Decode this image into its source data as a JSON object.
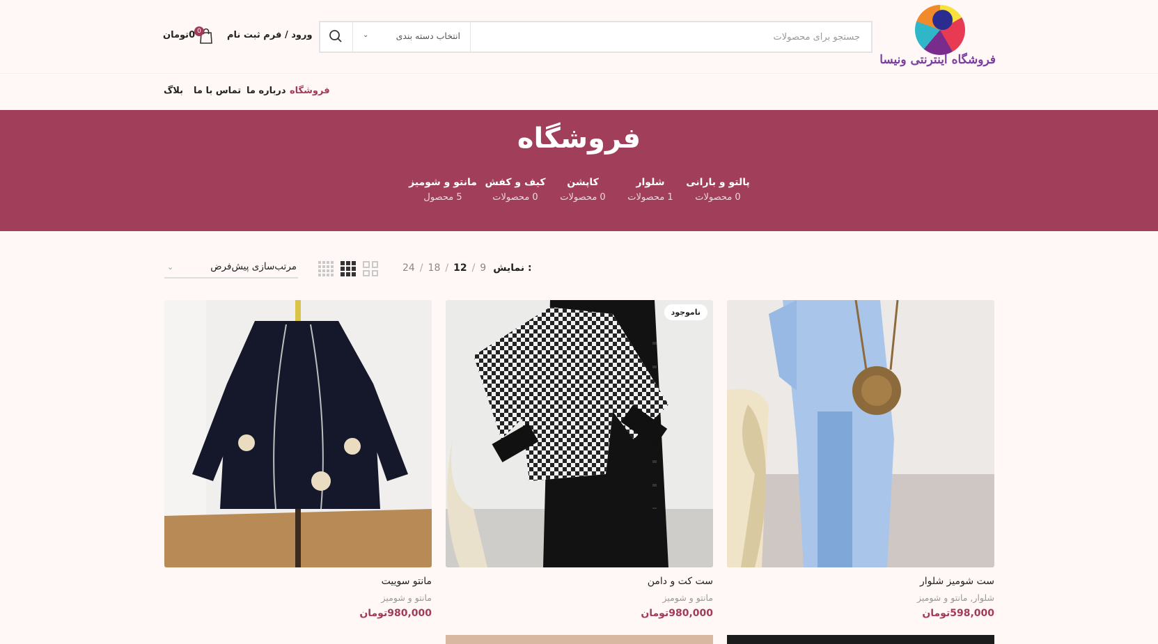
{
  "header": {
    "logo_text": "فروشگاه اینترنتی ونیسا",
    "search_placeholder": "جستجو برای محصولات",
    "category_select": "انتخاب دسته بندی",
    "account_label": "ورود / فرم ثبت نام",
    "cart_total": "0تومان",
    "cart_count": "0"
  },
  "nav": {
    "items": [
      {
        "label": "فروشگاه",
        "active": true
      },
      {
        "label": "درباره ما"
      },
      {
        "label": "تماس با ما"
      },
      {
        "label": "بلاگ"
      }
    ]
  },
  "banner": {
    "title": "فروشگاه",
    "categories": [
      {
        "name": "پالتو و بارانی",
        "count": "0 محصولات"
      },
      {
        "name": "شلوار",
        "count": "1 محصولات"
      },
      {
        "name": "کاپشن",
        "count": "0 محصولات"
      },
      {
        "name": "کیف و کفش",
        "count": "0 محصولات"
      },
      {
        "name": "مانتو و شومیز",
        "count": "5 محصول"
      }
    ]
  },
  "toolbar": {
    "show_label": "نمایش :",
    "per_page": [
      "9",
      "12",
      "18",
      "24"
    ],
    "per_page_active": "12",
    "sort_label": "مرتب‌سازی پیش‌فرض"
  },
  "products": [
    {
      "title": "ست شومیز شلوار",
      "category": "شلوار, مانتو و شومیز",
      "price": "598,000تومان",
      "badge": ""
    },
    {
      "title": "ست کت و دامن",
      "category": "مانتو و شومیز",
      "price": "980,000تومان",
      "badge": "ناموجود"
    },
    {
      "title": "مانتو سوییت",
      "category": "مانتو و شومیز",
      "price": "980,000تومان",
      "badge": ""
    }
  ],
  "colors": {
    "accent": "#a33a56",
    "banner": "#a13f5b",
    "background": "#fff8f7"
  }
}
